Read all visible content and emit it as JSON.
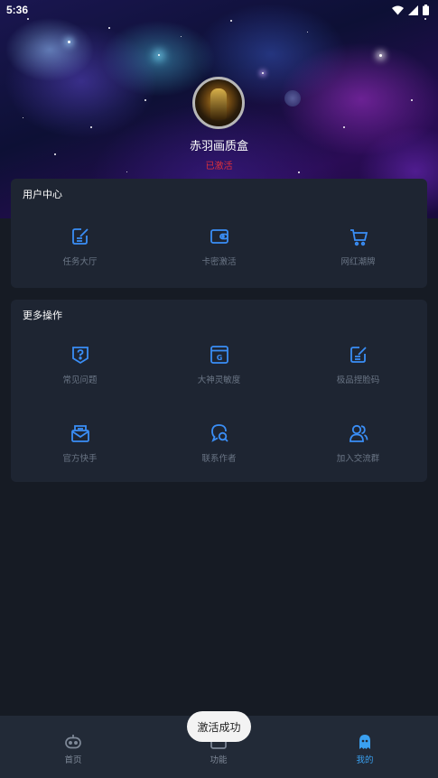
{
  "status_bar": {
    "time": "5:36"
  },
  "profile": {
    "name": "赤羽画质盒",
    "status": "已激活"
  },
  "user_center": {
    "title": "用户中心",
    "items": [
      {
        "label": "任务大厅",
        "icon": "edit-note-icon"
      },
      {
        "label": "卡密激活",
        "icon": "wallet-icon"
      },
      {
        "label": "网红潮牌",
        "icon": "shopping-cart-icon"
      }
    ]
  },
  "more_actions": {
    "title": "更多操作",
    "items": [
      {
        "label": "常见问题",
        "icon": "question-shield-icon"
      },
      {
        "label": "大神灵敏度",
        "icon": "gauge-window-icon"
      },
      {
        "label": "极品捏脸码",
        "icon": "edit-note-icon"
      },
      {
        "label": "官方快手",
        "icon": "mail-box-icon"
      },
      {
        "label": "联系作者",
        "icon": "chat-search-icon"
      },
      {
        "label": "加入交流群",
        "icon": "users-icon"
      }
    ]
  },
  "toast": {
    "message": "激活成功"
  },
  "bottom_nav": {
    "items": [
      {
        "label": "首页",
        "icon": "robot-icon",
        "active": false
      },
      {
        "label": "功能",
        "icon": "toolbox-icon",
        "active": false
      },
      {
        "label": "我的",
        "icon": "ghost-icon",
        "active": true
      }
    ]
  },
  "colors": {
    "accent": "#3a8ef6",
    "active_nav": "#3aa0f0",
    "status_activated": "#e0303a",
    "card_bg": "#1e2532",
    "page_bg": "#161b24"
  }
}
